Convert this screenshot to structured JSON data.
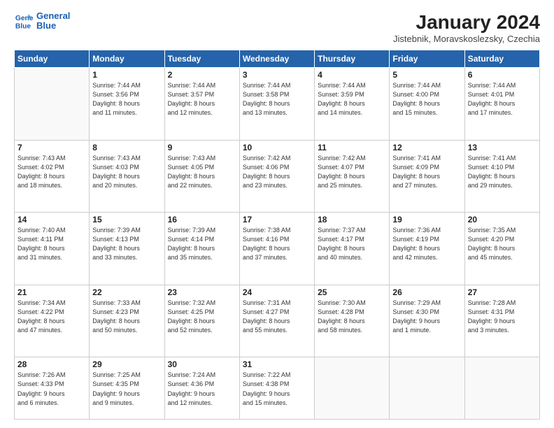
{
  "header": {
    "logo_line1": "General",
    "logo_line2": "Blue",
    "title": "January 2024",
    "subtitle": "Jistebnik, Moravskoslezsky, Czechia"
  },
  "weekdays": [
    "Sunday",
    "Monday",
    "Tuesday",
    "Wednesday",
    "Thursday",
    "Friday",
    "Saturday"
  ],
  "weeks": [
    [
      {
        "day": "",
        "info": ""
      },
      {
        "day": "1",
        "info": "Sunrise: 7:44 AM\nSunset: 3:56 PM\nDaylight: 8 hours\nand 11 minutes."
      },
      {
        "day": "2",
        "info": "Sunrise: 7:44 AM\nSunset: 3:57 PM\nDaylight: 8 hours\nand 12 minutes."
      },
      {
        "day": "3",
        "info": "Sunrise: 7:44 AM\nSunset: 3:58 PM\nDaylight: 8 hours\nand 13 minutes."
      },
      {
        "day": "4",
        "info": "Sunrise: 7:44 AM\nSunset: 3:59 PM\nDaylight: 8 hours\nand 14 minutes."
      },
      {
        "day": "5",
        "info": "Sunrise: 7:44 AM\nSunset: 4:00 PM\nDaylight: 8 hours\nand 15 minutes."
      },
      {
        "day": "6",
        "info": "Sunrise: 7:44 AM\nSunset: 4:01 PM\nDaylight: 8 hours\nand 17 minutes."
      }
    ],
    [
      {
        "day": "7",
        "info": "Sunrise: 7:43 AM\nSunset: 4:02 PM\nDaylight: 8 hours\nand 18 minutes."
      },
      {
        "day": "8",
        "info": "Sunrise: 7:43 AM\nSunset: 4:03 PM\nDaylight: 8 hours\nand 20 minutes."
      },
      {
        "day": "9",
        "info": "Sunrise: 7:43 AM\nSunset: 4:05 PM\nDaylight: 8 hours\nand 22 minutes."
      },
      {
        "day": "10",
        "info": "Sunrise: 7:42 AM\nSunset: 4:06 PM\nDaylight: 8 hours\nand 23 minutes."
      },
      {
        "day": "11",
        "info": "Sunrise: 7:42 AM\nSunset: 4:07 PM\nDaylight: 8 hours\nand 25 minutes."
      },
      {
        "day": "12",
        "info": "Sunrise: 7:41 AM\nSunset: 4:09 PM\nDaylight: 8 hours\nand 27 minutes."
      },
      {
        "day": "13",
        "info": "Sunrise: 7:41 AM\nSunset: 4:10 PM\nDaylight: 8 hours\nand 29 minutes."
      }
    ],
    [
      {
        "day": "14",
        "info": "Sunrise: 7:40 AM\nSunset: 4:11 PM\nDaylight: 8 hours\nand 31 minutes."
      },
      {
        "day": "15",
        "info": "Sunrise: 7:39 AM\nSunset: 4:13 PM\nDaylight: 8 hours\nand 33 minutes."
      },
      {
        "day": "16",
        "info": "Sunrise: 7:39 AM\nSunset: 4:14 PM\nDaylight: 8 hours\nand 35 minutes."
      },
      {
        "day": "17",
        "info": "Sunrise: 7:38 AM\nSunset: 4:16 PM\nDaylight: 8 hours\nand 37 minutes."
      },
      {
        "day": "18",
        "info": "Sunrise: 7:37 AM\nSunset: 4:17 PM\nDaylight: 8 hours\nand 40 minutes."
      },
      {
        "day": "19",
        "info": "Sunrise: 7:36 AM\nSunset: 4:19 PM\nDaylight: 8 hours\nand 42 minutes."
      },
      {
        "day": "20",
        "info": "Sunrise: 7:35 AM\nSunset: 4:20 PM\nDaylight: 8 hours\nand 45 minutes."
      }
    ],
    [
      {
        "day": "21",
        "info": "Sunrise: 7:34 AM\nSunset: 4:22 PM\nDaylight: 8 hours\nand 47 minutes."
      },
      {
        "day": "22",
        "info": "Sunrise: 7:33 AM\nSunset: 4:23 PM\nDaylight: 8 hours\nand 50 minutes."
      },
      {
        "day": "23",
        "info": "Sunrise: 7:32 AM\nSunset: 4:25 PM\nDaylight: 8 hours\nand 52 minutes."
      },
      {
        "day": "24",
        "info": "Sunrise: 7:31 AM\nSunset: 4:27 PM\nDaylight: 8 hours\nand 55 minutes."
      },
      {
        "day": "25",
        "info": "Sunrise: 7:30 AM\nSunset: 4:28 PM\nDaylight: 8 hours\nand 58 minutes."
      },
      {
        "day": "26",
        "info": "Sunrise: 7:29 AM\nSunset: 4:30 PM\nDaylight: 9 hours\nand 1 minute."
      },
      {
        "day": "27",
        "info": "Sunrise: 7:28 AM\nSunset: 4:31 PM\nDaylight: 9 hours\nand 3 minutes."
      }
    ],
    [
      {
        "day": "28",
        "info": "Sunrise: 7:26 AM\nSunset: 4:33 PM\nDaylight: 9 hours\nand 6 minutes."
      },
      {
        "day": "29",
        "info": "Sunrise: 7:25 AM\nSunset: 4:35 PM\nDaylight: 9 hours\nand 9 minutes."
      },
      {
        "day": "30",
        "info": "Sunrise: 7:24 AM\nSunset: 4:36 PM\nDaylight: 9 hours\nand 12 minutes."
      },
      {
        "day": "31",
        "info": "Sunrise: 7:22 AM\nSunset: 4:38 PM\nDaylight: 9 hours\nand 15 minutes."
      },
      {
        "day": "",
        "info": ""
      },
      {
        "day": "",
        "info": ""
      },
      {
        "day": "",
        "info": ""
      }
    ]
  ]
}
